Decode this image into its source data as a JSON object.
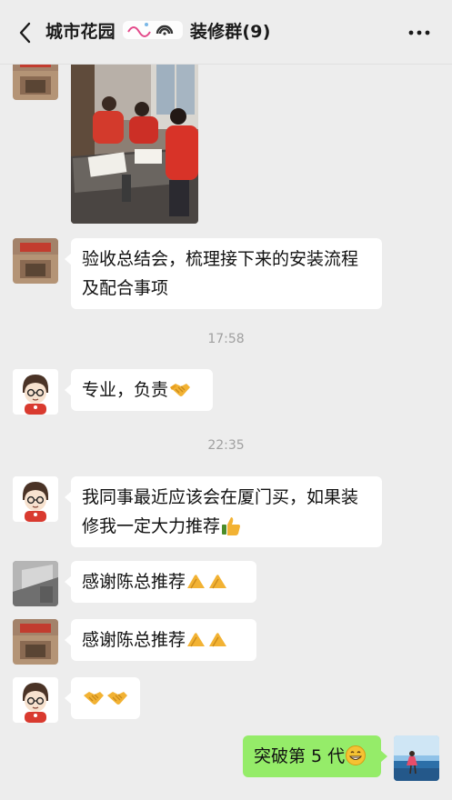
{
  "header": {
    "title_left": "城市花园",
    "title_right": "装修群(9)",
    "back_icon": "chevron-left-icon",
    "more_icon": "more-dots-icon"
  },
  "messages": {
    "m1": {
      "text": "验收总结会，梳理接下来的安装流程及配合事项"
    },
    "t1": "17:58",
    "m2": {
      "text": "专业，负责"
    },
    "t2": "22:35",
    "m3": {
      "text": "我同事最近应该会在厦门买，如果装修我一定大力推荐"
    },
    "m4": {
      "text": "感谢陈总推荐"
    },
    "m5": {
      "text": "感谢陈总推荐"
    },
    "m7": {
      "text": "突破第 5 代"
    }
  },
  "colors": {
    "background": "#ededed",
    "bubble_other": "#ffffff",
    "bubble_mine": "#95ec69",
    "timestamp": "#a0a0a0"
  }
}
